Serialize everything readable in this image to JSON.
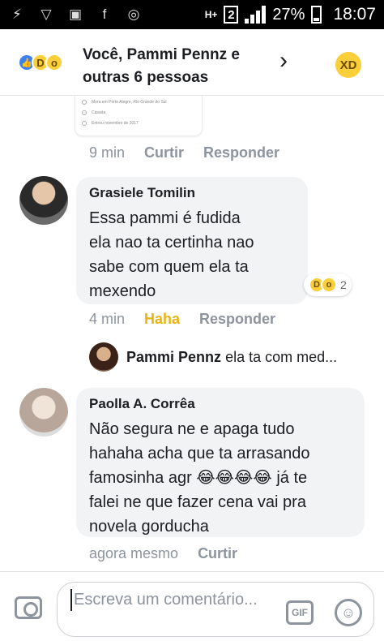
{
  "status_bar": {
    "icons": [
      "usb-icon",
      "vpn-icon",
      "image-icon",
      "facebook-icon",
      "voicemail-icon"
    ],
    "network": "H+",
    "sim": "2",
    "battery": "27%",
    "time": "18:07"
  },
  "header": {
    "reactions": [
      "like",
      "haha",
      "wow"
    ],
    "summary": "Você, Pammi Pennz e outras 6 pessoas",
    "chevron": "›"
  },
  "shared_card": {
    "lines": [
      "Mora em Porto Alegre, Rio Grande do Sul",
      "Casada",
      "Entrou novembro de 2017"
    ]
  },
  "first_meta": {
    "time": "9 min",
    "like": "Curtir",
    "reply": "Responder"
  },
  "comments": [
    {
      "author": "Grasiele Tomilin",
      "text": "Essa pammi é fudida\nela nao ta certinha nao\nsabe com quem ela ta\nmexendo",
      "reactions_count": "2",
      "time": "4 min",
      "reaction_label": "Haha",
      "reply": "Responder",
      "reply_preview": {
        "author": "Pammi Pennz",
        "text": "ela ta com med..."
      }
    },
    {
      "author": "Paolla A. Corrêa",
      "text": "Não segura ne e apaga tudo\nhahaha acha que ta arrasando\nfamosinha agr 😂😂😂😂 já te\nfalei ne que fazer cena vai pra\nnovela gorducha",
      "time": "agora mesmo",
      "like": "Curtir"
    }
  ],
  "composer": {
    "placeholder": "Escreva um comentário...",
    "gif": "GIF"
  }
}
